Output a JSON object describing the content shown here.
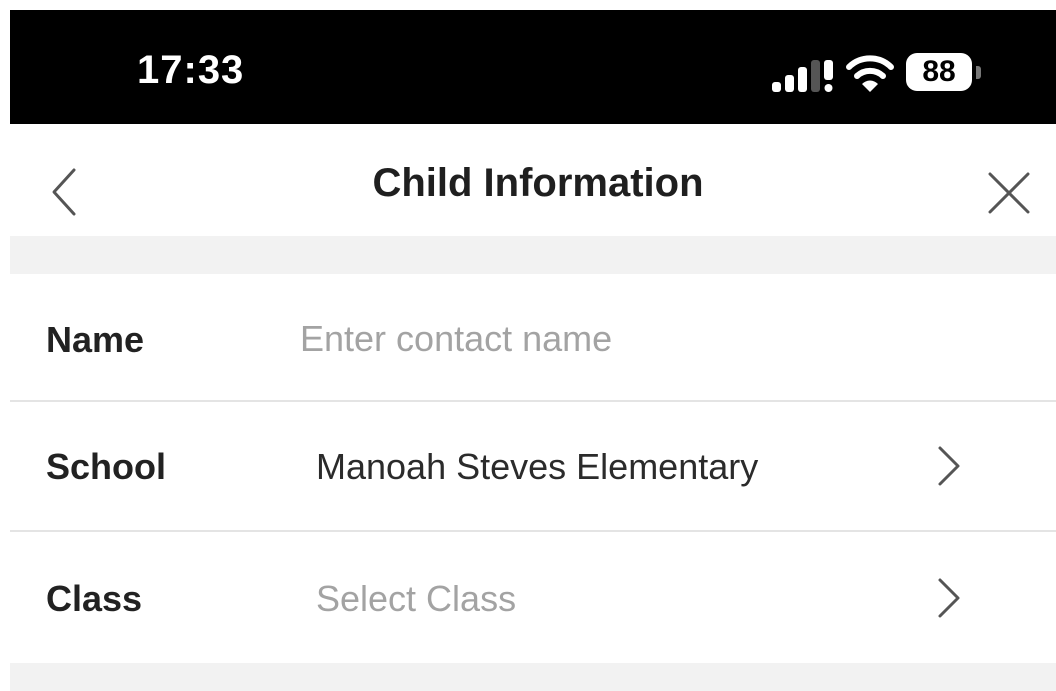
{
  "status_bar": {
    "time": "17:33",
    "battery_level": "88",
    "signal_icon": "cellular-signal-icon",
    "wifi_icon": "wifi-icon",
    "battery_icon": "battery-icon"
  },
  "nav": {
    "title": "Child Information",
    "back_icon": "chevron-left-icon",
    "close_icon": "close-icon"
  },
  "form": {
    "name": {
      "label": "Name",
      "value": "",
      "placeholder": "Enter contact name"
    },
    "school": {
      "label": "School",
      "value": "Manoah Steves Elementary",
      "chevron_icon": "chevron-right-icon"
    },
    "class": {
      "label": "Class",
      "placeholder": "Select Class",
      "chevron_icon": "chevron-right-icon"
    }
  },
  "colors": {
    "status_bar_bg": "#000000",
    "section_gap": "#f2f2f2",
    "placeholder_text": "#a3a3a3",
    "label_text": "#222222"
  }
}
